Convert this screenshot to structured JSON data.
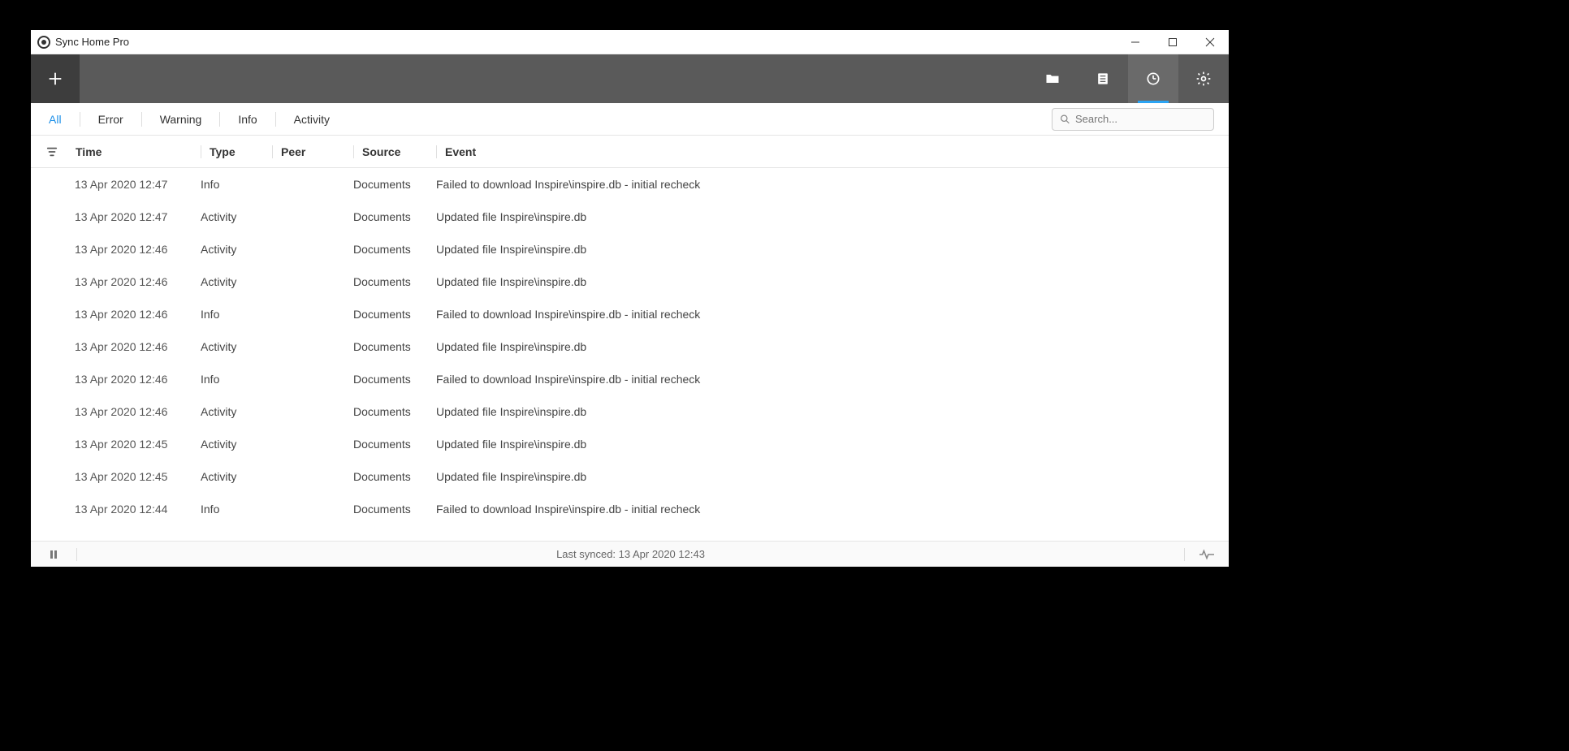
{
  "window": {
    "title": "Sync Home Pro"
  },
  "filters": {
    "tabs": [
      "All",
      "Error",
      "Warning",
      "Info",
      "Activity"
    ],
    "active_index": 0,
    "search_placeholder": "Search..."
  },
  "columns": {
    "time": "Time",
    "type": "Type",
    "peer": "Peer",
    "source": "Source",
    "event": "Event"
  },
  "rows": [
    {
      "time": "13 Apr 2020 12:47",
      "type": "Info",
      "peer": "████",
      "source": "Documents",
      "event": "Failed to download Inspire\\inspire.db - initial recheck"
    },
    {
      "time": "13 Apr 2020 12:47",
      "type": "Activity",
      "peer": "████",
      "source": "Documents",
      "event": "Updated file Inspire\\inspire.db"
    },
    {
      "time": "13 Apr 2020 12:46",
      "type": "Activity",
      "peer": "████",
      "source": "Documents",
      "event": "Updated file Inspire\\inspire.db"
    },
    {
      "time": "13 Apr 2020 12:46",
      "type": "Activity",
      "peer": "████",
      "source": "Documents",
      "event": "Updated file Inspire\\inspire.db"
    },
    {
      "time": "13 Apr 2020 12:46",
      "type": "Info",
      "peer": "████",
      "source": "Documents",
      "event": "Failed to download Inspire\\inspire.db - initial recheck"
    },
    {
      "time": "13 Apr 2020 12:46",
      "type": "Activity",
      "peer": "████",
      "source": "Documents",
      "event": "Updated file Inspire\\inspire.db"
    },
    {
      "time": "13 Apr 2020 12:46",
      "type": "Info",
      "peer": "████",
      "source": "Documents",
      "event": "Failed to download Inspire\\inspire.db - initial recheck"
    },
    {
      "time": "13 Apr 2020 12:46",
      "type": "Activity",
      "peer": "████",
      "source": "Documents",
      "event": "Updated file Inspire\\inspire.db"
    },
    {
      "time": "13 Apr 2020 12:45",
      "type": "Activity",
      "peer": "████",
      "source": "Documents",
      "event": "Updated file Inspire\\inspire.db"
    },
    {
      "time": "13 Apr 2020 12:45",
      "type": "Activity",
      "peer": "████",
      "source": "Documents",
      "event": "Updated file Inspire\\inspire.db"
    },
    {
      "time": "13 Apr 2020 12:44",
      "type": "Info",
      "peer": "████",
      "source": "Documents",
      "event": "Failed to download Inspire\\inspire.db - initial recheck"
    }
  ],
  "status": {
    "text": "Last synced: 13 Apr 2020 12:43"
  }
}
